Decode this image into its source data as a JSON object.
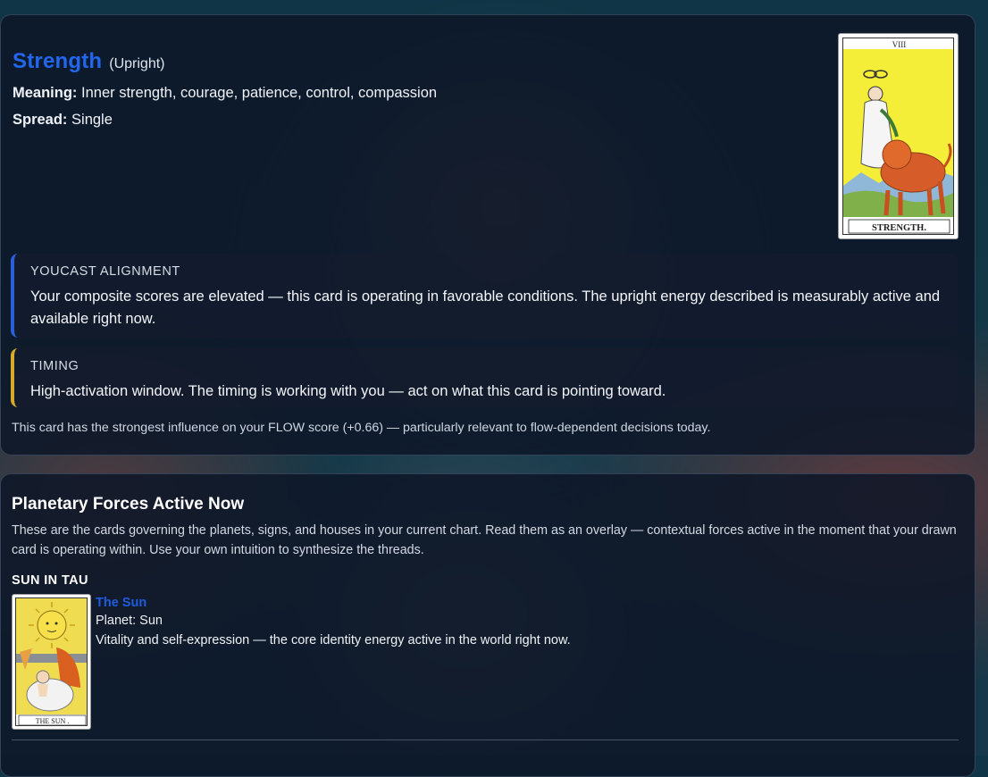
{
  "card": {
    "name": "Strength",
    "orientation": "(Upright)",
    "meaning_label": "Meaning:",
    "meaning": "Inner strength, courage, patience, control, compassion",
    "spread_label": "Spread:",
    "spread": "Single",
    "image": {
      "numeral": "VIII",
      "caption": "STRENGTH."
    }
  },
  "alignment": {
    "label": "YOUCAST ALIGNMENT",
    "text": "Your composite scores are elevated — this card is operating in favorable conditions. The upright energy described is measurably active and available right now."
  },
  "timing": {
    "label": "TIMING",
    "text": "High-activation window. The timing is working with you — act on what this card is pointing toward."
  },
  "footnote": "This card has the strongest influence on your FLOW score (+0.66) — particularly relevant to flow-dependent decisions today.",
  "planetary": {
    "title": "Planetary Forces Active Now",
    "description": "These are the cards governing the planets, signs, and houses in your current chart. Read them as an overlay — contextual forces active in the moment that your drawn card is operating within. Use your own intuition to synthesize the threads.",
    "forces": [
      {
        "heading": "SUN IN TAU",
        "card_name": "The Sun",
        "planet": "Planet: Sun",
        "description": "Vitality and self-expression — the core identity energy active in the world right now.",
        "image_caption": "THE SUN ."
      }
    ]
  },
  "colors": {
    "card_title": "#2266ee",
    "alignment_accent": "#2b5fd8",
    "timing_accent": "#d8a92a",
    "link_blue": "#1f5ce0"
  }
}
